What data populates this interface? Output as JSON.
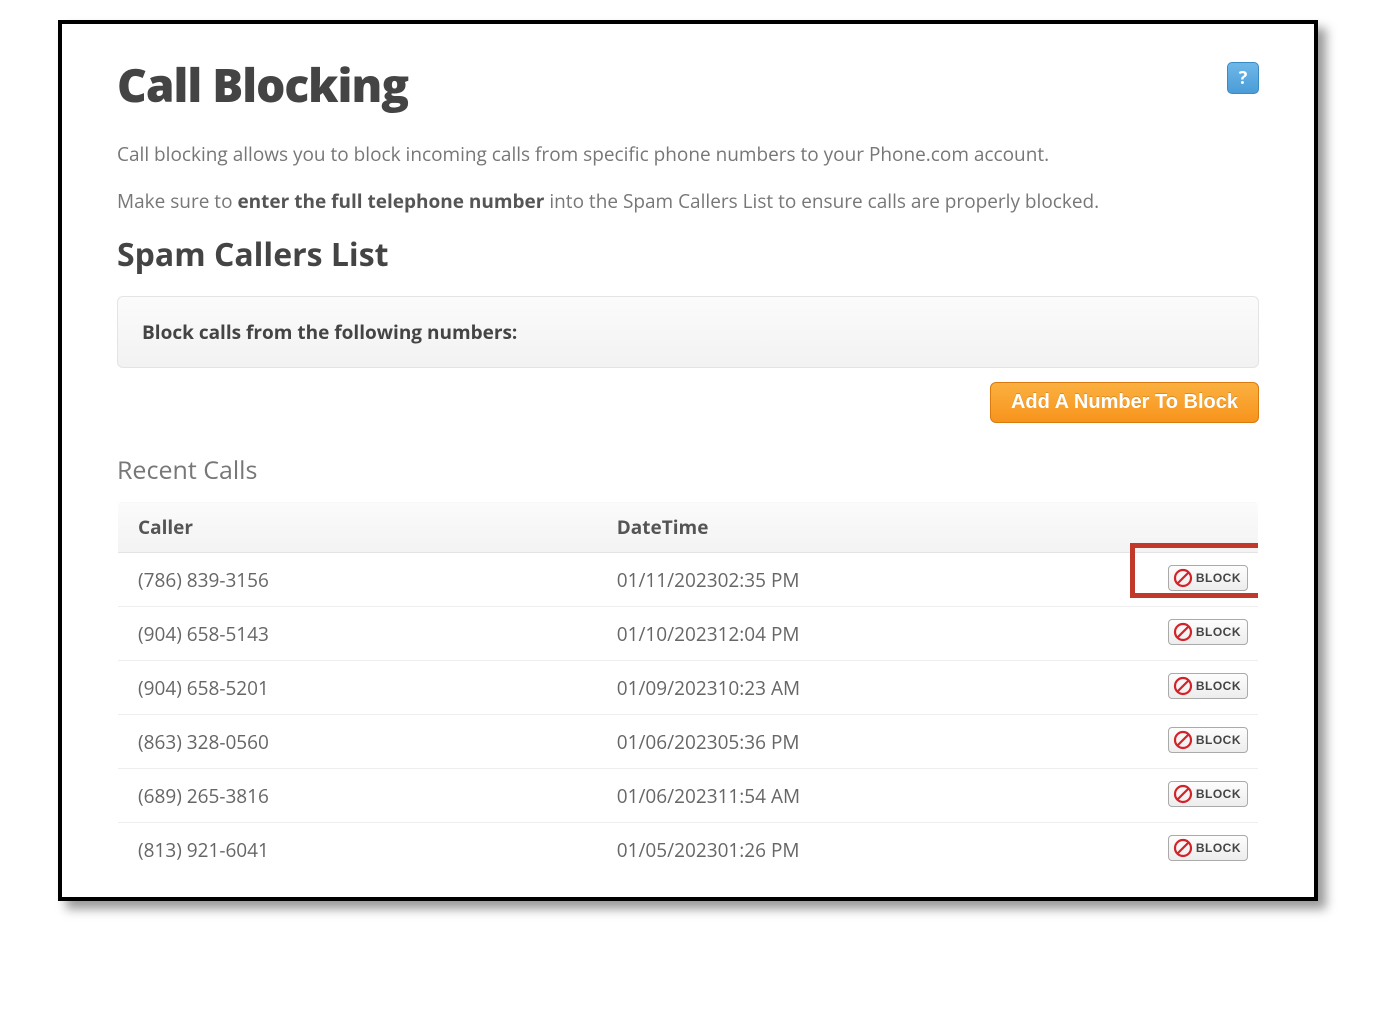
{
  "page": {
    "title": "Call Blocking",
    "help_label": "?",
    "desc1": "Call blocking allows you to block incoming calls from specific phone numbers to your Phone.com account.",
    "desc2_pre": "Make sure to ",
    "desc2_strong": "enter the full telephone number",
    "desc2_post": " into the Spam Callers List to ensure calls are properly blocked."
  },
  "spam_list": {
    "heading": "Spam Callers List",
    "panel_text": "Block calls from the following numbers:",
    "add_button": "Add A Number To Block"
  },
  "recent": {
    "heading": "Recent Calls",
    "columns": {
      "caller": "Caller",
      "datetime": "DateTime"
    },
    "block_label": "BLOCK",
    "rows": [
      {
        "caller": "(786) 839-3156",
        "datetime": "01/11/202302:35 PM"
      },
      {
        "caller": "(904) 658-5143",
        "datetime": "01/10/202312:04 PM"
      },
      {
        "caller": "(904) 658-5201",
        "datetime": "01/09/202310:23 AM"
      },
      {
        "caller": "(863) 328-0560",
        "datetime": "01/06/202305:36 PM"
      },
      {
        "caller": "(689) 265-3816",
        "datetime": "01/06/202311:54 AM"
      },
      {
        "caller": "(813) 921-6041",
        "datetime": "01/05/202301:26 PM"
      }
    ]
  },
  "annotation": {
    "highlight_row_index": 0
  }
}
